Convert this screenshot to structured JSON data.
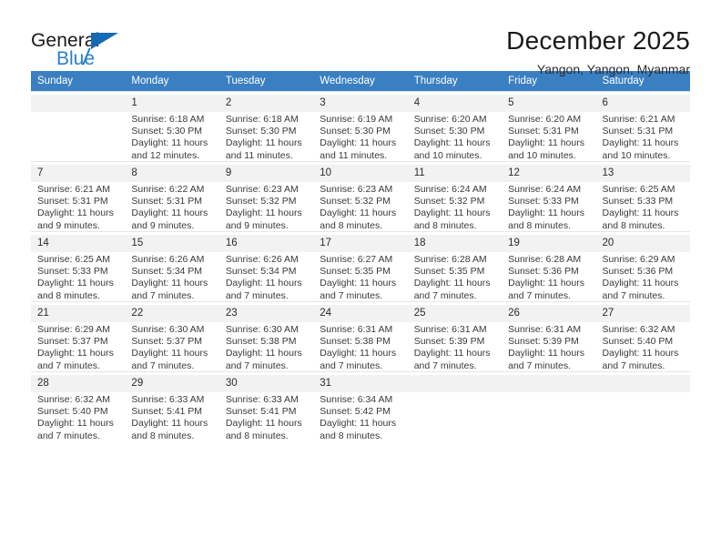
{
  "brand": {
    "line1": "General",
    "line2": "Blue",
    "triangle_color": "#1669b3",
    "blue_color": "#2a7fc9"
  },
  "header": {
    "title": "December 2025",
    "subtitle": "Yangon, Yangon, Myanmar"
  },
  "theme": {
    "header_bg": "#3a7fc1",
    "band_bg": "#f2f2f2",
    "row_divider": "#e6e6e6"
  },
  "weekdays": [
    "Sunday",
    "Monday",
    "Tuesday",
    "Wednesday",
    "Thursday",
    "Friday",
    "Saturday"
  ],
  "labels": {
    "sunrise": "Sunrise:",
    "sunset": "Sunset:",
    "daylight": "Daylight:"
  },
  "weeks": [
    [
      {
        "day": ""
      },
      {
        "day": "1",
        "sunrise": "Sunrise: 6:18 AM",
        "sunset": "Sunset: 5:30 PM",
        "daylight1": "Daylight: 11 hours",
        "daylight2": "and 12 minutes."
      },
      {
        "day": "2",
        "sunrise": "Sunrise: 6:18 AM",
        "sunset": "Sunset: 5:30 PM",
        "daylight1": "Daylight: 11 hours",
        "daylight2": "and 11 minutes."
      },
      {
        "day": "3",
        "sunrise": "Sunrise: 6:19 AM",
        "sunset": "Sunset: 5:30 PM",
        "daylight1": "Daylight: 11 hours",
        "daylight2": "and 11 minutes."
      },
      {
        "day": "4",
        "sunrise": "Sunrise: 6:20 AM",
        "sunset": "Sunset: 5:30 PM",
        "daylight1": "Daylight: 11 hours",
        "daylight2": "and 10 minutes."
      },
      {
        "day": "5",
        "sunrise": "Sunrise: 6:20 AM",
        "sunset": "Sunset: 5:31 PM",
        "daylight1": "Daylight: 11 hours",
        "daylight2": "and 10 minutes."
      },
      {
        "day": "6",
        "sunrise": "Sunrise: 6:21 AM",
        "sunset": "Sunset: 5:31 PM",
        "daylight1": "Daylight: 11 hours",
        "daylight2": "and 10 minutes."
      }
    ],
    [
      {
        "day": "7",
        "sunrise": "Sunrise: 6:21 AM",
        "sunset": "Sunset: 5:31 PM",
        "daylight1": "Daylight: 11 hours",
        "daylight2": "and 9 minutes."
      },
      {
        "day": "8",
        "sunrise": "Sunrise: 6:22 AM",
        "sunset": "Sunset: 5:31 PM",
        "daylight1": "Daylight: 11 hours",
        "daylight2": "and 9 minutes."
      },
      {
        "day": "9",
        "sunrise": "Sunrise: 6:23 AM",
        "sunset": "Sunset: 5:32 PM",
        "daylight1": "Daylight: 11 hours",
        "daylight2": "and 9 minutes."
      },
      {
        "day": "10",
        "sunrise": "Sunrise: 6:23 AM",
        "sunset": "Sunset: 5:32 PM",
        "daylight1": "Daylight: 11 hours",
        "daylight2": "and 8 minutes."
      },
      {
        "day": "11",
        "sunrise": "Sunrise: 6:24 AM",
        "sunset": "Sunset: 5:32 PM",
        "daylight1": "Daylight: 11 hours",
        "daylight2": "and 8 minutes."
      },
      {
        "day": "12",
        "sunrise": "Sunrise: 6:24 AM",
        "sunset": "Sunset: 5:33 PM",
        "daylight1": "Daylight: 11 hours",
        "daylight2": "and 8 minutes."
      },
      {
        "day": "13",
        "sunrise": "Sunrise: 6:25 AM",
        "sunset": "Sunset: 5:33 PM",
        "daylight1": "Daylight: 11 hours",
        "daylight2": "and 8 minutes."
      }
    ],
    [
      {
        "day": "14",
        "sunrise": "Sunrise: 6:25 AM",
        "sunset": "Sunset: 5:33 PM",
        "daylight1": "Daylight: 11 hours",
        "daylight2": "and 8 minutes."
      },
      {
        "day": "15",
        "sunrise": "Sunrise: 6:26 AM",
        "sunset": "Sunset: 5:34 PM",
        "daylight1": "Daylight: 11 hours",
        "daylight2": "and 7 minutes."
      },
      {
        "day": "16",
        "sunrise": "Sunrise: 6:26 AM",
        "sunset": "Sunset: 5:34 PM",
        "daylight1": "Daylight: 11 hours",
        "daylight2": "and 7 minutes."
      },
      {
        "day": "17",
        "sunrise": "Sunrise: 6:27 AM",
        "sunset": "Sunset: 5:35 PM",
        "daylight1": "Daylight: 11 hours",
        "daylight2": "and 7 minutes."
      },
      {
        "day": "18",
        "sunrise": "Sunrise: 6:28 AM",
        "sunset": "Sunset: 5:35 PM",
        "daylight1": "Daylight: 11 hours",
        "daylight2": "and 7 minutes."
      },
      {
        "day": "19",
        "sunrise": "Sunrise: 6:28 AM",
        "sunset": "Sunset: 5:36 PM",
        "daylight1": "Daylight: 11 hours",
        "daylight2": "and 7 minutes."
      },
      {
        "day": "20",
        "sunrise": "Sunrise: 6:29 AM",
        "sunset": "Sunset: 5:36 PM",
        "daylight1": "Daylight: 11 hours",
        "daylight2": "and 7 minutes."
      }
    ],
    [
      {
        "day": "21",
        "sunrise": "Sunrise: 6:29 AM",
        "sunset": "Sunset: 5:37 PM",
        "daylight1": "Daylight: 11 hours",
        "daylight2": "and 7 minutes."
      },
      {
        "day": "22",
        "sunrise": "Sunrise: 6:30 AM",
        "sunset": "Sunset: 5:37 PM",
        "daylight1": "Daylight: 11 hours",
        "daylight2": "and 7 minutes."
      },
      {
        "day": "23",
        "sunrise": "Sunrise: 6:30 AM",
        "sunset": "Sunset: 5:38 PM",
        "daylight1": "Daylight: 11 hours",
        "daylight2": "and 7 minutes."
      },
      {
        "day": "24",
        "sunrise": "Sunrise: 6:31 AM",
        "sunset": "Sunset: 5:38 PM",
        "daylight1": "Daylight: 11 hours",
        "daylight2": "and 7 minutes."
      },
      {
        "day": "25",
        "sunrise": "Sunrise: 6:31 AM",
        "sunset": "Sunset: 5:39 PM",
        "daylight1": "Daylight: 11 hours",
        "daylight2": "and 7 minutes."
      },
      {
        "day": "26",
        "sunrise": "Sunrise: 6:31 AM",
        "sunset": "Sunset: 5:39 PM",
        "daylight1": "Daylight: 11 hours",
        "daylight2": "and 7 minutes."
      },
      {
        "day": "27",
        "sunrise": "Sunrise: 6:32 AM",
        "sunset": "Sunset: 5:40 PM",
        "daylight1": "Daylight: 11 hours",
        "daylight2": "and 7 minutes."
      }
    ],
    [
      {
        "day": "28",
        "sunrise": "Sunrise: 6:32 AM",
        "sunset": "Sunset: 5:40 PM",
        "daylight1": "Daylight: 11 hours",
        "daylight2": "and 7 minutes."
      },
      {
        "day": "29",
        "sunrise": "Sunrise: 6:33 AM",
        "sunset": "Sunset: 5:41 PM",
        "daylight1": "Daylight: 11 hours",
        "daylight2": "and 8 minutes."
      },
      {
        "day": "30",
        "sunrise": "Sunrise: 6:33 AM",
        "sunset": "Sunset: 5:41 PM",
        "daylight1": "Daylight: 11 hours",
        "daylight2": "and 8 minutes."
      },
      {
        "day": "31",
        "sunrise": "Sunrise: 6:34 AM",
        "sunset": "Sunset: 5:42 PM",
        "daylight1": "Daylight: 11 hours",
        "daylight2": "and 8 minutes."
      },
      {
        "day": ""
      },
      {
        "day": ""
      },
      {
        "day": ""
      }
    ]
  ]
}
